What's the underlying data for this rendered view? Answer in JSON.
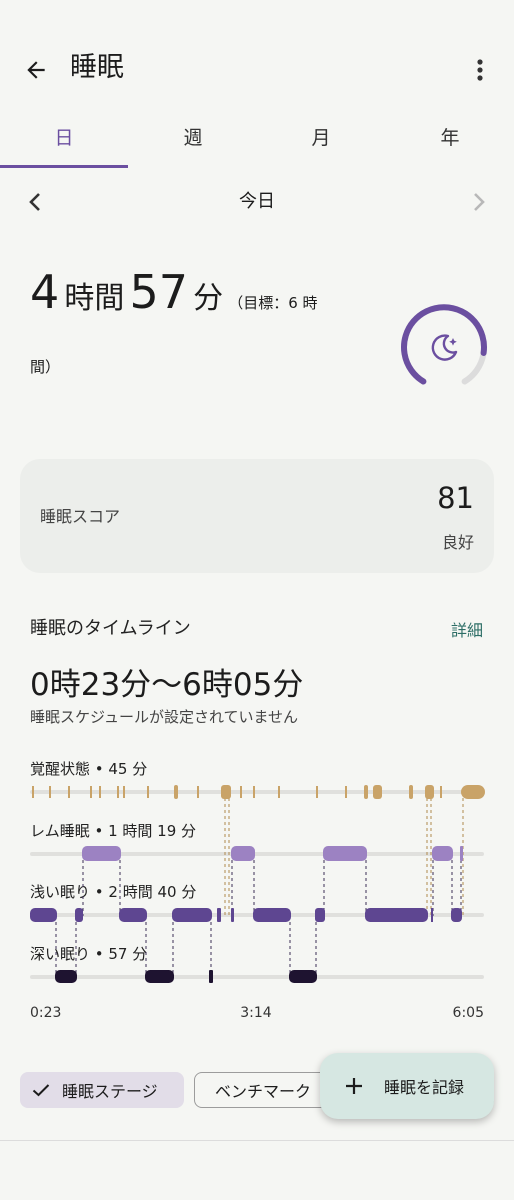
{
  "header": {
    "title": "睡眠",
    "back_icon": "arrow-back-icon",
    "menu_icon": "more-vert-icon"
  },
  "tabs": [
    {
      "label": "日",
      "active": true
    },
    {
      "label": "週",
      "active": false
    },
    {
      "label": "月",
      "active": false
    },
    {
      "label": "年",
      "active": false
    }
  ],
  "date_nav": {
    "label": "今日"
  },
  "summary": {
    "hours": "4",
    "hours_unit": "時間",
    "minutes": "57",
    "minutes_unit": "分",
    "goal_part1": "（目標：6 時",
    "goal_part2": "間）",
    "goal_progress": 0.83,
    "ring_icon": "moon-stars-icon"
  },
  "score": {
    "label": "睡眠スコア",
    "value": "81",
    "rating": "良好"
  },
  "timeline": {
    "title": "睡眠のタイムライン",
    "detail_link": "詳細",
    "range": "0時23分〜6時05分",
    "note": "睡眠スケジュールが設定されていません"
  },
  "chart_data": {
    "type": "timeline",
    "x_labels": [
      "0:23",
      "3:14",
      "6:05"
    ],
    "stages": [
      {
        "name": "覚醒状態 • 45 分",
        "color": "#c9a368"
      },
      {
        "name": "レム睡眠 • 1 時間 19 分",
        "color": "#9c82c2"
      },
      {
        "name": "浅い眠り • 2 時間 40 分",
        "color": "#5e4691"
      },
      {
        "name": "深い眠り • 57 分",
        "color": "#1e1330"
      }
    ],
    "colors": {
      "track": "#e0e0dd"
    }
  },
  "bottom": {
    "chip_selected": "睡眠ステージ",
    "chip_selected_icon": "check-icon",
    "chip_other": "ベンチマーク",
    "fab_label": "睡眠を記録",
    "fab_icon": "plus-icon"
  },
  "colors": {
    "accent": "#6b4fa0",
    "link": "#2d6e66"
  }
}
